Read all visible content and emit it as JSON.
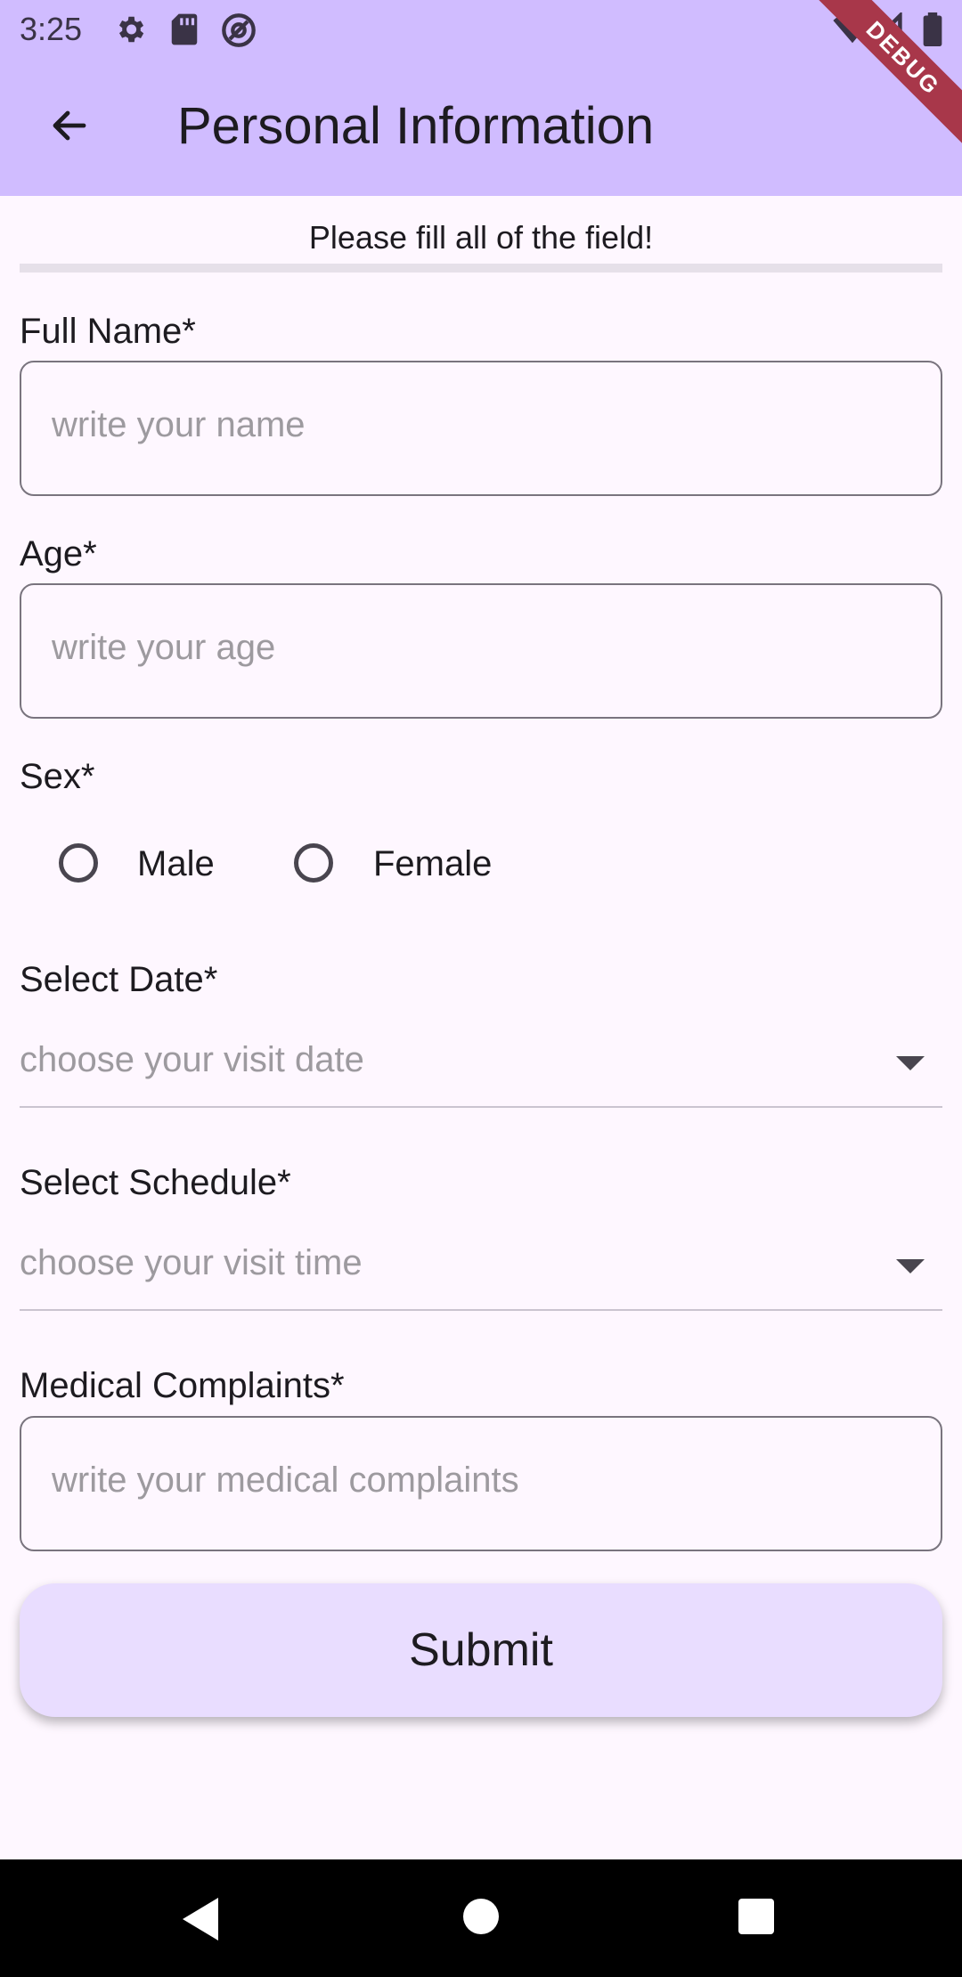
{
  "status": {
    "time": "3:25",
    "icons": [
      "gear-icon",
      "sd-card-icon",
      "at-sign-icon",
      "wifi-icon",
      "signal-icon",
      "battery-icon"
    ]
  },
  "appbar": {
    "title": "Personal Information",
    "back_icon": "arrow-back-icon",
    "debug_banner": "DEBUG",
    "color": "#d0bcff"
  },
  "form": {
    "notice": "Please fill all of the field!",
    "full_name": {
      "label": "Full Name*",
      "placeholder": "write your name"
    },
    "age": {
      "label": "Age*",
      "placeholder": "write your age"
    },
    "sex": {
      "label": "Sex*",
      "options": [
        "Male",
        "Female"
      ]
    },
    "date": {
      "label": "Select Date*",
      "placeholder": "choose your visit date"
    },
    "schedule": {
      "label": "Select Schedule*",
      "placeholder": "choose your visit time"
    },
    "complaints": {
      "label": "Medical Complaints*",
      "placeholder": "write your medical complaints"
    },
    "submit_label": "Submit",
    "submit_color": "#e9ddff"
  },
  "navbar": {
    "icons": [
      "nav-back-icon",
      "nav-home-icon",
      "nav-recents-icon"
    ]
  }
}
